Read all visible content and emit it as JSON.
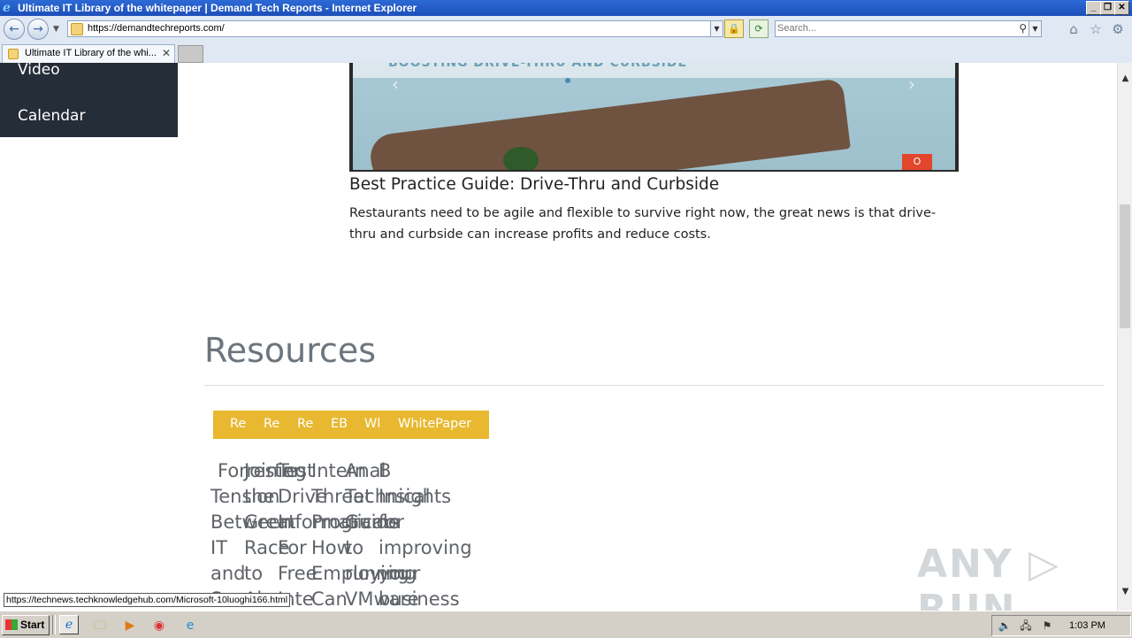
{
  "window": {
    "title": "Ultimate IT Library of the whitepaper | Demand Tech Reports - Internet Explorer",
    "buttons": {
      "minimize": "_",
      "restore": "❐",
      "close": "✕"
    }
  },
  "navbar": {
    "back_icon": "back-arrow-icon",
    "forward_icon": "forward-arrow-icon",
    "address": "https://demandtechreports.com/",
    "search_placeholder": "Search...",
    "glyphs": {
      "back": "←",
      "forward": "→",
      "dropdown": "▼",
      "lock": "🔒",
      "refresh": "⟳",
      "search": "⚲",
      "home": "⌂",
      "favorites": "☆",
      "settings": "⚙"
    }
  },
  "tabs": [
    {
      "label": "Ultimate IT Library of the whi...",
      "close": "✕"
    }
  ],
  "sidenav": {
    "items": [
      "Video",
      "Calendar"
    ]
  },
  "banner": {
    "strip_text": "BOOSTING DRIVE-THRU AND CURBSIDE",
    "prev": "‹",
    "next": "›",
    "badge": "O"
  },
  "post": {
    "title": "Best Practice Guide: Drive-Thru and Curbside",
    "description": "Restaurants need to be agile and flexible to survive right now, the great news is that drive-thru and curbside can increase profits and reduce costs."
  },
  "resources": {
    "heading": "Resources",
    "filters": [
      "Re",
      "Re",
      "Re",
      "EB",
      "Wl",
      "WhitePaper"
    ],
    "cards": [
      [
        "Forrester",
        "Tension",
        "Between",
        "IT",
        "and",
        "S"
      ],
      [
        "Joining",
        "the",
        "Great",
        "Race",
        "to",
        "Ai"
      ],
      [
        "Test",
        "Drive",
        "Informatica",
        "For",
        "Free",
        "Inte"
      ],
      [
        "Intern",
        "Threat",
        "Programs",
        "How",
        "Employing",
        "Can"
      ],
      [
        "Anal",
        "Technical",
        "Guide",
        "to",
        "running",
        "VMware"
      ],
      [
        "B",
        "Insights",
        "for",
        "improving",
        "your",
        "business"
      ]
    ]
  },
  "status_url": "https://technews.techknowledgehub.com/Microsoft-10luoghi166.html",
  "watermark": "ANY ▷ RUN",
  "scrollbar": {
    "up": "▲",
    "down": "▼"
  },
  "taskbar": {
    "start_label": "Start",
    "clock": "1:03 PM",
    "icons": {
      "ie": "e",
      "explorer": "🗀",
      "media": "▶",
      "chrome": "◉",
      "edge": "e"
    },
    "tray_icons": {
      "volume": "🔈",
      "network": "🖧",
      "flag": "⚑"
    }
  }
}
